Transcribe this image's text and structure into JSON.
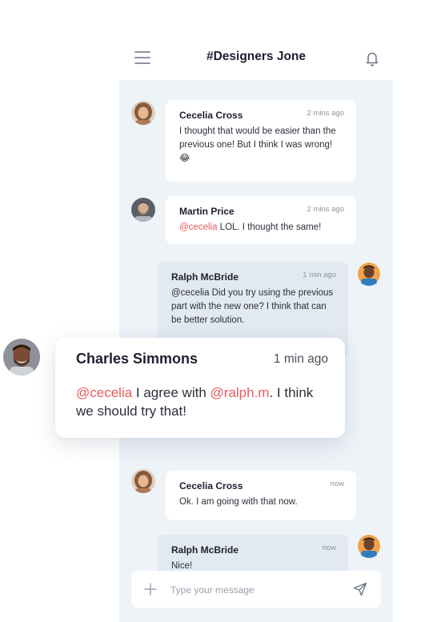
{
  "header": {
    "title": "#Designers Jone"
  },
  "messages": [
    {
      "name": "Cecelia Cross",
      "time": "2 mins ago",
      "text": "I thought that would be easier than the previous one! But I think I was wrong! 😂"
    },
    {
      "name": "Martin Price",
      "time": "2 mins ago",
      "mention": "@cecelia",
      "text": " LOL. I thought the same!"
    },
    {
      "name": "Ralph McBride",
      "time": "1 min ago",
      "text": "@cecelia Did you try using the previous part with the new one? I think that can be better solution."
    },
    {
      "name": "Cecelia Cross",
      "time": "now",
      "text": "Ok. I am going with that now."
    },
    {
      "name": "Ralph McBride",
      "time": "now",
      "text": "Nice!"
    }
  ],
  "highlight": {
    "name": "Charles Simmons",
    "time": "1 min ago",
    "mention1": "@cecelia",
    "text1": " I agree with ",
    "mention2": "@ralph.m",
    "text2": ". I think we should try that!"
  },
  "composer": {
    "placeholder": "Type your message"
  },
  "colors": {
    "mention": "#e95a5a",
    "feed_bg": "#eef3f8",
    "own_bubble": "#e2e9f1"
  },
  "icons": [
    "menu-icon",
    "bell-icon",
    "plus-icon",
    "send-icon"
  ]
}
